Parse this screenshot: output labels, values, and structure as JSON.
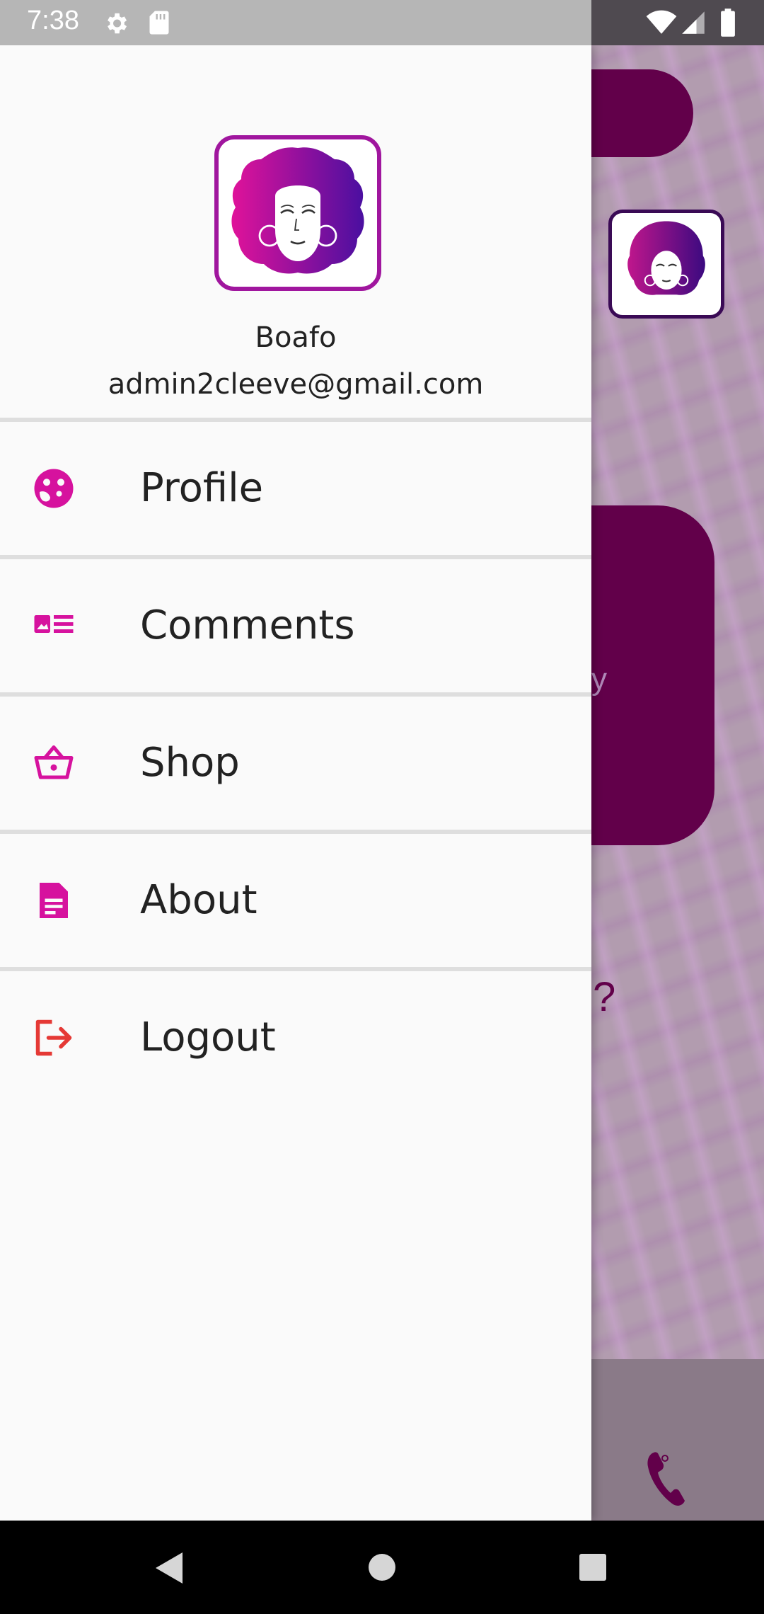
{
  "status_bar": {
    "time": "7:38",
    "icons": [
      "gear-icon",
      "sd-card-icon",
      "wifi-icon",
      "signal-icon",
      "battery-icon"
    ]
  },
  "background": {
    "partial_text": "y",
    "question_mark": "?"
  },
  "drawer": {
    "user": {
      "name": "Boafo",
      "email": "admin2cleeve@gmail.com"
    },
    "menu_items": [
      {
        "label": "Profile",
        "icon": "profile-palette-icon",
        "icon_color": "#d6129e"
      },
      {
        "label": "Comments",
        "icon": "comments-card-icon",
        "icon_color": "#d6129e"
      },
      {
        "label": "Shop",
        "icon": "basket-icon",
        "icon_color": "#d6129e"
      },
      {
        "label": "About",
        "icon": "document-icon",
        "icon_color": "#d6129e"
      },
      {
        "label": "Logout",
        "icon": "logout-icon",
        "icon_color": "#e53935"
      }
    ]
  },
  "colors": {
    "accent": "#d6129e",
    "logo_border": "#a0169e",
    "background_dark": "#62004a",
    "logout": "#e53935"
  }
}
